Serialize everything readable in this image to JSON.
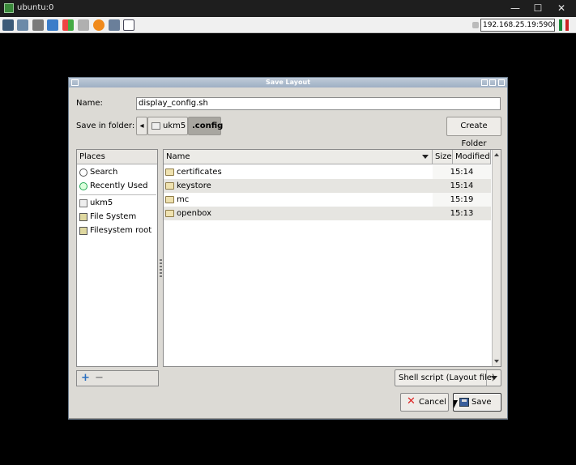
{
  "viewer": {
    "title": "ubuntu:0",
    "address": "192.168.25.19:5900",
    "controls": {
      "minimize": "—",
      "maximize": "☐",
      "close": "✕"
    }
  },
  "dialog": {
    "title": "Save Layout",
    "name_label": "Name:",
    "name_value": "display_config.sh",
    "save_in_label": "Save in folder:",
    "path": [
      {
        "label": "ukm5",
        "active": false
      },
      {
        "label": ".config",
        "active": true
      }
    ],
    "create_folder_label": "Create Folder",
    "places": {
      "header": "Places",
      "items": [
        {
          "label": "Search",
          "icon": "search-icon"
        },
        {
          "label": "Recently Used",
          "icon": "recent-icon"
        },
        {
          "label": "ukm5",
          "icon": "folder-icon"
        },
        {
          "label": "File System",
          "icon": "drive-icon"
        },
        {
          "label": "Filesystem root",
          "icon": "drive-icon"
        }
      ]
    },
    "columns": {
      "name": "Name",
      "size": "Size",
      "modified": "Modified"
    },
    "files": [
      {
        "name": "certificates",
        "size": "",
        "modified": "15:14"
      },
      {
        "name": "keystore",
        "size": "",
        "modified": "15:14"
      },
      {
        "name": "mc",
        "size": "",
        "modified": "15:19"
      },
      {
        "name": "openbox",
        "size": "",
        "modified": "15:13"
      }
    ],
    "filter": "Shell script (Layout file)",
    "cancel_label": "Cancel",
    "save_label": "Save"
  },
  "colors": {
    "dialog_bg": "#dcdad5",
    "title_gradient": "#9eafc3",
    "row_alt": "#e6e5e1"
  }
}
